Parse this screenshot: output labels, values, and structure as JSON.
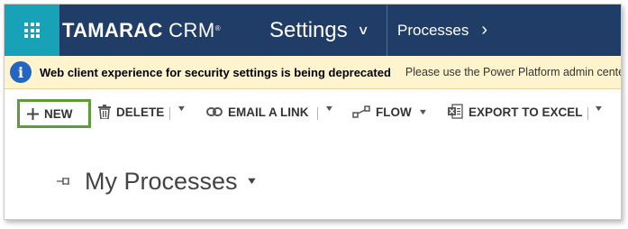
{
  "header": {
    "logo_bold": "TAMARAC",
    "logo_light": "CRM",
    "logo_mark": "®",
    "nav_settings": "Settings",
    "nav_processes": "Processes"
  },
  "notification": {
    "title": "Web client experience for security settings is being deprecated",
    "message": "Please use the Power Platform admin cente"
  },
  "toolbar": {
    "new_label": "NEW",
    "delete_label": "DELETE",
    "email_label": "EMAIL A LINK",
    "flow_label": "FLOW",
    "export_label": "EXPORT TO EXCEL"
  },
  "view": {
    "title": "My Processes"
  },
  "colors": {
    "header_bg": "#1f3d66",
    "waffle_bg": "#17a2b8",
    "notice_bg": "#fff4ce",
    "info_blue": "#2266c2",
    "highlight_green": "#5f9b3a"
  },
  "icons": {
    "waffle": "app-launcher-icon",
    "info": "info-icon",
    "new": "plus-icon",
    "delete": "trash-icon",
    "email": "link-icon",
    "flow": "flow-icon",
    "export": "excel-icon",
    "pin": "pin-icon"
  }
}
